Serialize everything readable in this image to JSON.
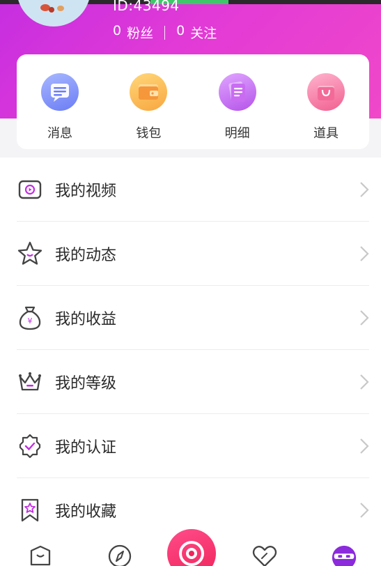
{
  "colors": {
    "header_gradient_start": "#c62ee0",
    "header_gradient_end": "#f048c8",
    "icon_accent": "#c02fe0",
    "record_button": "#f0245a"
  },
  "user": {
    "id_text": "ID:43494",
    "fans_count": "0",
    "fans_label": "粉丝",
    "following_count": "0",
    "following_label": "关注"
  },
  "quick_actions": [
    {
      "label": "消息",
      "icon": "message-icon"
    },
    {
      "label": "钱包",
      "icon": "wallet-icon"
    },
    {
      "label": "明细",
      "icon": "details-icon"
    },
    {
      "label": "道具",
      "icon": "shopping-bag-icon"
    }
  ],
  "menu": [
    {
      "label": "我的视频",
      "icon": "video-icon"
    },
    {
      "label": "我的动态",
      "icon": "star-icon"
    },
    {
      "label": "我的收益",
      "icon": "money-bag-icon"
    },
    {
      "label": "我的等级",
      "icon": "crown-icon"
    },
    {
      "label": "我的认证",
      "icon": "verified-badge-icon"
    },
    {
      "label": "我的收藏",
      "icon": "bookmark-star-icon"
    }
  ],
  "bottom_nav": [
    {
      "icon": "home-shield-icon"
    },
    {
      "icon": "compass-icon"
    },
    {
      "icon": "record-camera-icon"
    },
    {
      "icon": "heart-icon"
    },
    {
      "icon": "profile-face-icon"
    }
  ]
}
